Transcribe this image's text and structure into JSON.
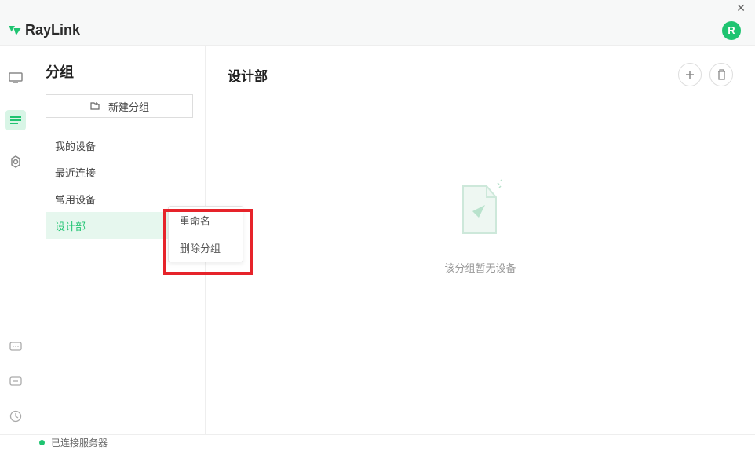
{
  "window": {
    "minimize": "—",
    "close": "✕"
  },
  "brand": {
    "name": "RayLink",
    "avatar_letter": "R"
  },
  "nav": {
    "items": [
      {
        "id": "monitor",
        "active": false
      },
      {
        "id": "list",
        "active": true
      },
      {
        "id": "settings",
        "active": false
      }
    ],
    "bottom": [
      {
        "id": "chat"
      },
      {
        "id": "feedback"
      },
      {
        "id": "help"
      }
    ]
  },
  "sidebar": {
    "title": "分组",
    "new_group_label": "新建分组",
    "groups": [
      {
        "label": "我的设备",
        "selected": false
      },
      {
        "label": "最近连接",
        "selected": false
      },
      {
        "label": "常用设备",
        "selected": false
      },
      {
        "label": "设计部",
        "selected": true
      }
    ]
  },
  "context_menu": {
    "rename": "重命名",
    "delete": "删除分组"
  },
  "main": {
    "title": "设计部",
    "empty_text": "该分组暂无设备"
  },
  "status": {
    "text": "已连接服务器"
  }
}
